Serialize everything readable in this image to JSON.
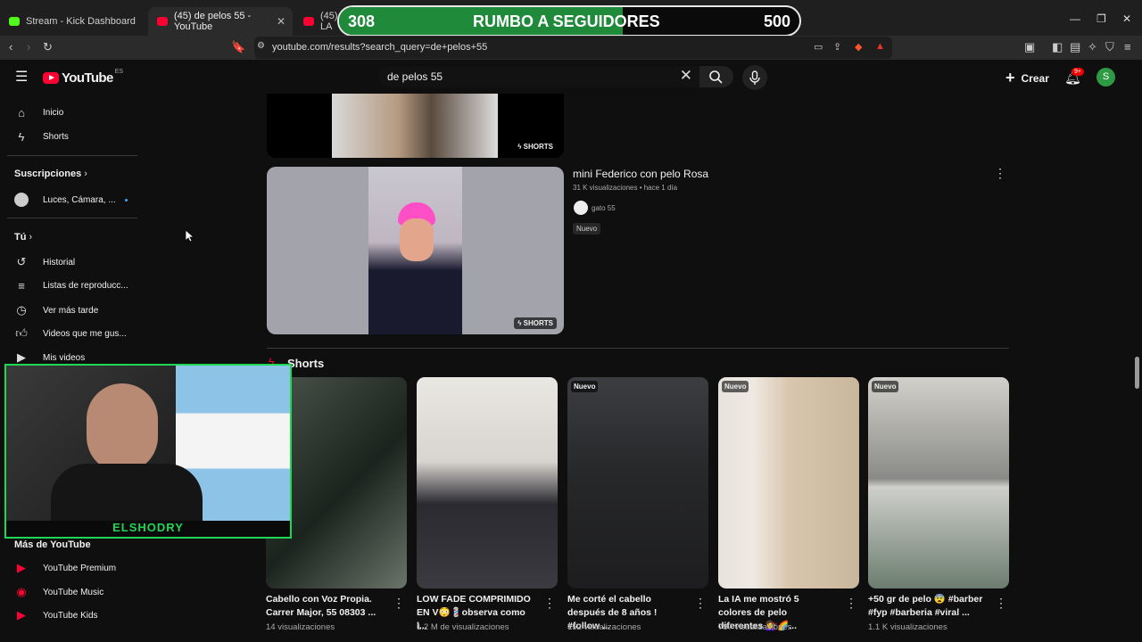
{
  "browser": {
    "tabs": [
      {
        "label": "Stream - Kick Dashboard",
        "color": "#53fc18"
      },
      {
        "label": "(45) de pelos 55 - YouTube",
        "color": "#ff0033"
      },
      {
        "label": "(45) LA",
        "color": "#ff0033"
      }
    ],
    "url": "youtube.com/results?search_query=de+pelos+55"
  },
  "overlay": {
    "current": "308",
    "title": "RUMBO A SEGUIDORES",
    "goal": "500",
    "progress": 0.616
  },
  "header": {
    "logo": "YouTube",
    "region": "ES",
    "search_query": "de pelos 55",
    "create_label": "Crear",
    "notif_badge": "9+",
    "avatar_letter": "S"
  },
  "sidebar": {
    "main": [
      {
        "label": "Inicio",
        "icon": "home-icon"
      },
      {
        "label": "Shorts",
        "icon": "shorts-icon"
      }
    ],
    "subs_heading": "Suscripciones",
    "subs": [
      {
        "label": "Luces, Cámara, ..."
      }
    ],
    "you_heading": "Tú",
    "you": [
      {
        "label": "Historial",
        "icon": "history-icon"
      },
      {
        "label": "Listas de reproducc...",
        "icon": "playlist-icon"
      },
      {
        "label": "Ver más tarde",
        "icon": "clock-icon"
      },
      {
        "label": "Videos que me gus...",
        "icon": "thumbs-up-icon"
      },
      {
        "label": "Mis videos",
        "icon": "my-videos-icon"
      }
    ],
    "more_heading": "Más de YouTube",
    "more": [
      {
        "label": "YouTube Premium"
      },
      {
        "label": "YouTube Music"
      },
      {
        "label": "YouTube Kids"
      }
    ]
  },
  "results": {
    "top_shorts_label": "SHORTS",
    "video": {
      "title": "mini Federico con pelo Rosa",
      "meta": "31 K visualizaciones • hace 1 día",
      "channel": "gato 55",
      "badge": "Nuevo",
      "shorts_label": "SHORTS"
    }
  },
  "shorts_section": {
    "heading": "Shorts",
    "items": [
      {
        "title": "Cabello con Voz Propia. Carrer Major, 55 08303 ...",
        "views": "14 visualizaciones",
        "badge": ""
      },
      {
        "title": "LOW FADE COMPRIMIDO EN V😳💈observa como l...",
        "views": "1.2 M de visualizaciones",
        "badge": ""
      },
      {
        "title": "Me corté el cabello después de 8 años ! #follow ...",
        "views": "152 visualizaciones",
        "badge": "Nuevo"
      },
      {
        "title": "La IA me mostró 5 colores de pelo diferentes 💇‍♀️🌈...",
        "views": "797 visualizaciones",
        "badge": "Nuevo"
      },
      {
        "title": "+50 gr de pelo 😨 #barber #fyp #barberia #viral ...",
        "views": "1.1 K visualizaciones",
        "badge": "Nuevo"
      }
    ]
  },
  "webcam": {
    "name": "ELSHODRY"
  }
}
